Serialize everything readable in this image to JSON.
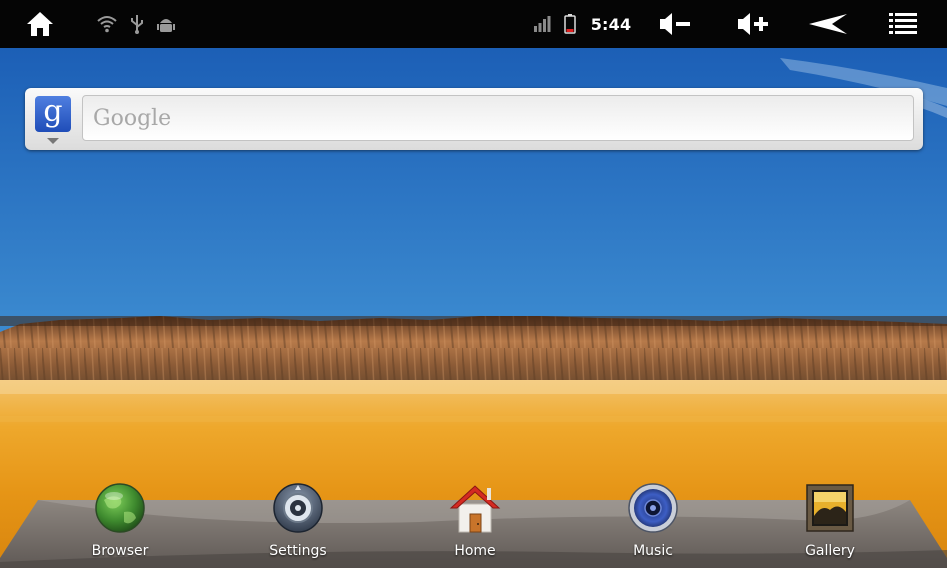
{
  "status_bar": {
    "time": "5:44",
    "left_icons": [
      "home-icon",
      "wifi-icon",
      "usb-icon",
      "android-debug-icon"
    ],
    "right_icons": [
      "signal-bars-icon",
      "battery-low-icon",
      "volume-down-icon",
      "volume-up-icon",
      "back-icon",
      "menu-icon"
    ],
    "battery_color": "#e02020"
  },
  "search": {
    "placeholder": "Google",
    "logo_letter": "g"
  },
  "dock": {
    "items": [
      {
        "label": "Browser",
        "icon": "globe-icon"
      },
      {
        "label": "Settings",
        "icon": "settings-dial-icon"
      },
      {
        "label": "Home",
        "icon": "house-icon"
      },
      {
        "label": "Music",
        "icon": "speaker-icon"
      },
      {
        "label": "Gallery",
        "icon": "picture-frame-icon"
      }
    ]
  },
  "colors": {
    "sky_top": "#1f63b8",
    "sky_bottom": "#7ab6e2",
    "desert": "#e89a1e",
    "dock_bar": "#7a736d"
  }
}
